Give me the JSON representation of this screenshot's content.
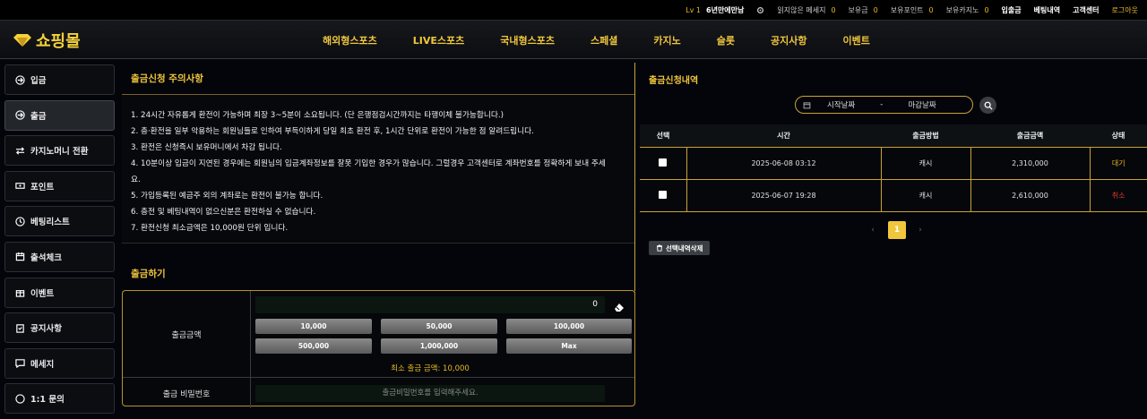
{
  "topbar": {
    "level": "Lv 1",
    "user": "6년만에만남",
    "unread_label": "읽지않은 메세지",
    "unread_count": "0",
    "holding_label": "보유금",
    "holding_value": "0",
    "points_label": "보유포인트",
    "points_value": "0",
    "casino_label": "보유카지노",
    "casino_value": "0",
    "deposit": "입출금",
    "betting": "베팅내역",
    "support": "고객센터",
    "logout": "로그아웃"
  },
  "logo": {
    "text": "쇼핑몰"
  },
  "menu": [
    "해외형스포츠",
    "LIVE스포츠",
    "국내형스포츠",
    "스페셜",
    "카지노",
    "슬롯",
    "공지사항",
    "이벤트"
  ],
  "sidebar": [
    {
      "label": "입금",
      "icon": "deposit-icon"
    },
    {
      "label": "출금",
      "icon": "withdraw-icon"
    },
    {
      "label": "카지노머니 전환",
      "icon": "exchange-icon"
    },
    {
      "label": "포인트",
      "icon": "point-icon"
    },
    {
      "label": "베팅리스트",
      "icon": "history-icon"
    },
    {
      "label": "출석체크",
      "icon": "calendar-icon"
    },
    {
      "label": "이벤트",
      "icon": "gift-icon"
    },
    {
      "label": "공지사항",
      "icon": "clipboard-icon"
    },
    {
      "label": "메세지",
      "icon": "message-icon"
    },
    {
      "label": "1:1 문의",
      "icon": "help-icon"
    }
  ],
  "notice": {
    "title": "출금신청 주의사항",
    "lines": [
      "1. 24시간 자유롭게 환전이 가능하며 최장 3~5분이 소요됩니다. (단 은행점검시간까지는 타행이체 불가능합니다.)",
      "2. 충·환전을 일부 악용하는 회원님들로 인하여 부득이하게 당일 최초 환전 후, 1시간 단위로 환전이 가능한 점 알려드립니다.",
      "3. 환전은 신청즉시 보유머니에서 차감 됩니다.",
      "4. 10분이상 입금이 지연된 경우에는 회원님의 입금계좌정보를 잘못 기입한 경우가 많습니다. 그럴경우 고객센터로 계좌번호를 정확하게 보내 주세",
      "요.",
      "5. 가입등록된 예금주 외의 계좌로는 환전이 불가능 합니다.",
      "6. 충전 및 베팅내역이 없으신분은 환전하실 수 없습니다.",
      "7. 환전신청 최소금액은 10,000원 단위 입니다."
    ]
  },
  "withdraw": {
    "title": "출금하기",
    "amount_label": "출금금액",
    "amount_value": "0",
    "quick": [
      "10,000",
      "50,000",
      "100,000",
      "500,000",
      "1,000,000",
      "Max"
    ],
    "min_text": "최소 출금 금액: 10,000",
    "password_label": "출금 비밀번호",
    "password_placeholder": "출금비밀번호를 입력해주세요."
  },
  "history": {
    "title": "출금신청내역",
    "start_placeholder": "시작날짜",
    "sep": "-",
    "end_placeholder": "마감날짜",
    "columns": [
      "선택",
      "시간",
      "출금방법",
      "출금금액",
      "상태"
    ],
    "rows": [
      {
        "time": "2025-06-08 03:12",
        "method": "캐시",
        "amount": "2,310,000",
        "status": "대기",
        "status_color": "#e8b923"
      },
      {
        "time": "2025-06-07 19:28",
        "method": "캐시",
        "amount": "2,610,000",
        "status": "취소",
        "status_color": "#e53935"
      }
    ],
    "pagination": {
      "prev": "‹",
      "page": "1",
      "next": "›"
    },
    "delete_label": "선택내역삭제"
  },
  "colors": {
    "accent": "#f0c63c",
    "border_gold": "#caa23a",
    "bg": "#03050a"
  }
}
